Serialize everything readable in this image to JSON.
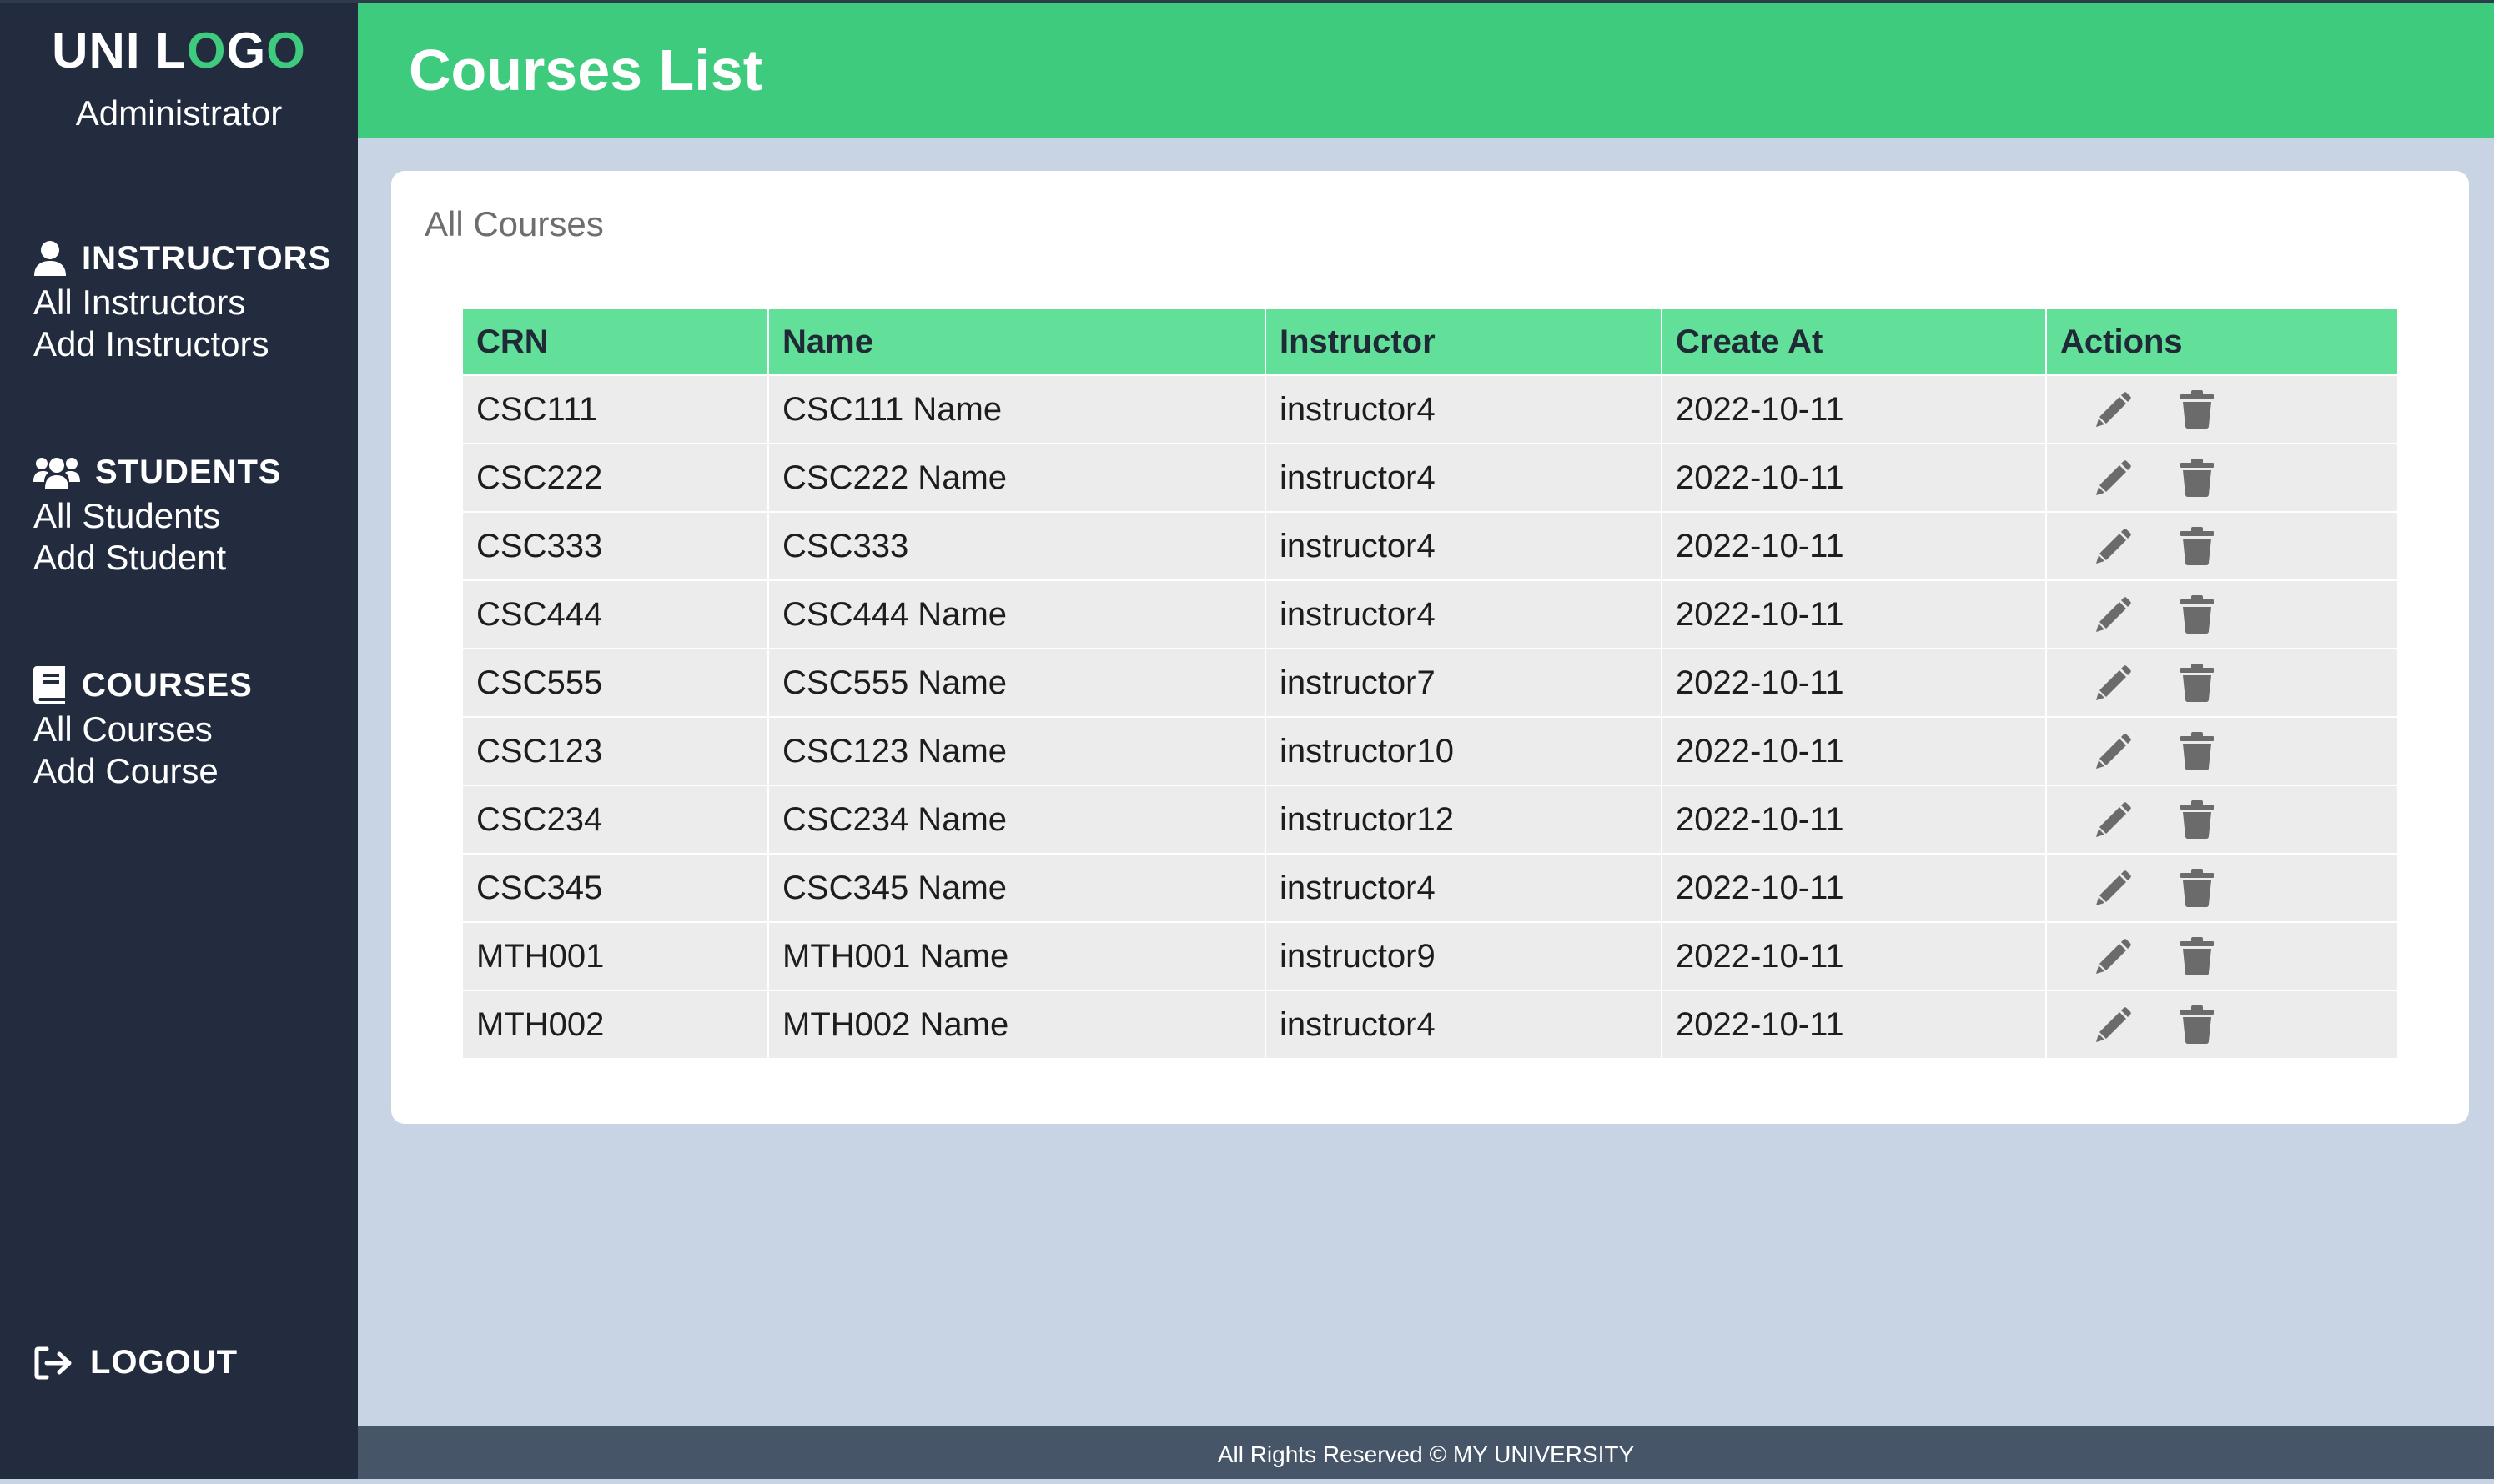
{
  "sidebar": {
    "logo_part1": "UNI L",
    "logo_o1": "O",
    "logo_part2": "G",
    "logo_o2": "O",
    "role": "Administrator",
    "sections": {
      "instructors": {
        "heading": "INSTRUCTORS",
        "links": [
          "All Instructors",
          "Add Instructors"
        ],
        "icon": "user-icon"
      },
      "students": {
        "heading": "STUDENTS",
        "links": [
          "All Students",
          "Add Student"
        ],
        "icon": "users-icon"
      },
      "courses": {
        "heading": "COURSES",
        "links": [
          "All Courses",
          "Add Course"
        ],
        "icon": "book-icon"
      }
    },
    "logout_label": "LOGOUT",
    "logout_icon": "logout-icon"
  },
  "header": {
    "title": "Courses List"
  },
  "card": {
    "title": "All Courses"
  },
  "table": {
    "columns": [
      "CRN",
      "Name",
      "Instructor",
      "Create At",
      "Actions"
    ],
    "rows": [
      {
        "crn": "CSC111",
        "name": "CSC111 Name",
        "instructor": "instructor4",
        "created": "2022-10-11"
      },
      {
        "crn": "CSC222",
        "name": "CSC222 Name",
        "instructor": "instructor4",
        "created": "2022-10-11"
      },
      {
        "crn": "CSC333",
        "name": "CSC333",
        "instructor": "instructor4",
        "created": "2022-10-11"
      },
      {
        "crn": "CSC444",
        "name": "CSC444 Name",
        "instructor": "instructor4",
        "created": "2022-10-11"
      },
      {
        "crn": "CSC555",
        "name": "CSC555 Name",
        "instructor": "instructor7",
        "created": "2022-10-11"
      },
      {
        "crn": "CSC123",
        "name": "CSC123 Name",
        "instructor": "instructor10",
        "created": "2022-10-11"
      },
      {
        "crn": "CSC234",
        "name": "CSC234 Name",
        "instructor": "instructor12",
        "created": "2022-10-11"
      },
      {
        "crn": "CSC345",
        "name": "CSC345 Name",
        "instructor": "instructor4",
        "created": "2022-10-11"
      },
      {
        "crn": "MTH001",
        "name": "MTH001 Name",
        "instructor": "instructor9",
        "created": "2022-10-11"
      },
      {
        "crn": "MTH002",
        "name": "MTH002 Name",
        "instructor": "instructor4",
        "created": "2022-10-11"
      }
    ],
    "action_icons": [
      "pencil-icon",
      "trash-icon"
    ]
  },
  "footer": {
    "text": "All Rights Reserved © MY UNIVERSITY"
  },
  "colors": {
    "accent": "#3ecb7d",
    "header_row": "#62e09a",
    "sidebar": "#232c3f",
    "background": "#c8d3e4",
    "footer": "#475569",
    "icon": "#6b6b6b"
  }
}
